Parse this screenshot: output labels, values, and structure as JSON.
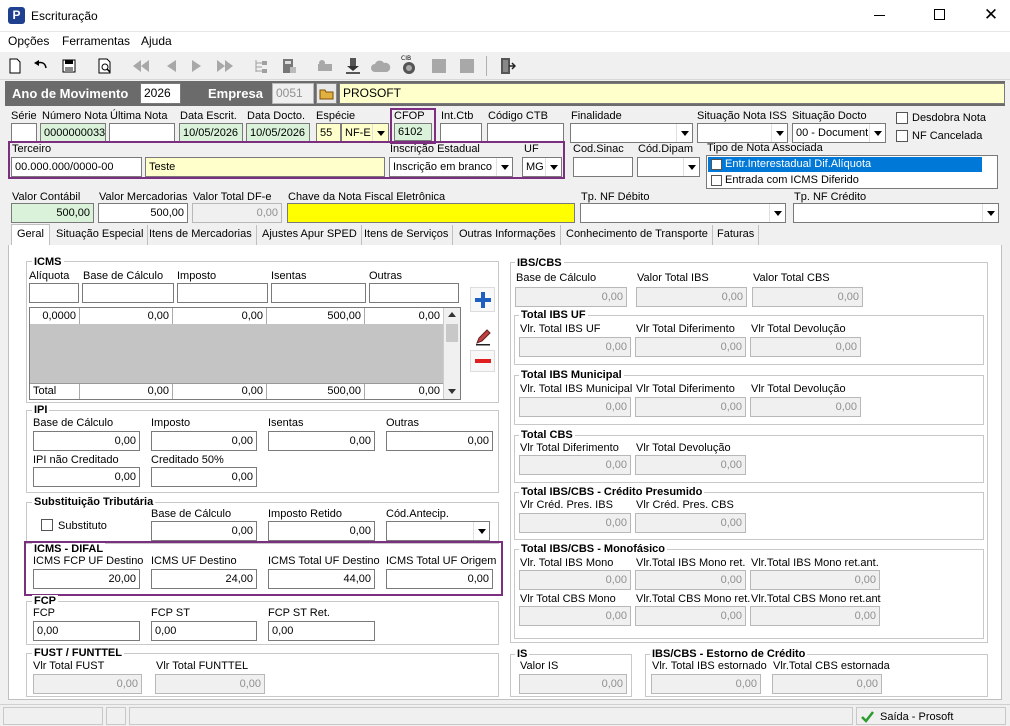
{
  "window": {
    "title": "Escrituração",
    "logo": "P"
  },
  "menu": [
    "Opções",
    "Ferramentas",
    "Ajuda"
  ],
  "top": {
    "ano_label": "Ano de Movimento",
    "ano": "2026",
    "empresa_label": "Empresa",
    "empresa_code": "0051",
    "empresa_name": "PROSOFT"
  },
  "labels": {
    "serie": "Série",
    "numero": "Número Nota",
    "ultima": "Última Nota",
    "data_escrit": "Data Escrit.",
    "data_docto": "Data Docto.",
    "especie": "Espécie",
    "cfop": "CFOP",
    "int_ctb": "Int.Ctb",
    "cod_ctb": "Código CTB",
    "finalidade": "Finalidade",
    "sit_iss": "Situação Nota ISS",
    "sit_docto": "Situação Docto",
    "desdobra": "Desdobra Nota",
    "nf_cancelada": "NF Cancelada",
    "terceiro": "Terceiro",
    "insc_est": "Inscrição Estadual",
    "uf": "UF",
    "cod_sinac": "Cod.Sinac",
    "cod_dipam": "Cód.Dipam",
    "tipo_nota": "Tipo de Nota Associada",
    "valor_contabil": "Valor Contábil",
    "valor_merc": "Valor Mercadorias",
    "valor_dfe": "Valor Total DF-e",
    "chave": "Chave da Nota Fiscal Eletrônica",
    "tp_deb": "Tp. NF Débito",
    "tp_cred": "Tp. NF Crédito"
  },
  "values": {
    "numero": "0000000033",
    "data_escrit": "10/05/2026",
    "data_docto": "10/05/2026",
    "especie_code": "55",
    "especie": "NF-E",
    "cfop": "6102",
    "sit_docto": "00 - Document",
    "terceiro_doc": "00.000.000/0000-00",
    "terceiro_nome": "Teste",
    "insc_est": "Inscrição em branco",
    "uf": "MG",
    "valor_contabil": "500,00",
    "valor_merc": "500,00",
    "valor_dfe": "0,00"
  },
  "tipo_nota_items": [
    "Entr.Interestadual Dif.Alíquota",
    "Entrada com ICMS Diferido"
  ],
  "tabs": [
    "Geral",
    "Situação Especial",
    "Itens de Mercadorias",
    "Ajustes Apur SPED",
    "Itens de Serviços",
    "Outras Informações",
    "Conhecimento de Transporte",
    "Faturas"
  ],
  "icms": {
    "title": "ICMS",
    "cols": [
      "Alíquota",
      "Base de Cálculo",
      "Imposto",
      "Isentas",
      "Outras"
    ],
    "row": [
      "0,0000",
      "0,00",
      "0,00",
      "500,00",
      "0,00"
    ],
    "total_label": "Total",
    "total": [
      "0,00",
      "0,00",
      "500,00",
      "0,00"
    ]
  },
  "ipi": {
    "title": "IPI",
    "base_l": "Base de Cálculo",
    "imposto_l": "Imposto",
    "isentas_l": "Isentas",
    "outras_l": "Outras",
    "base": "0,00",
    "imposto": "0,00",
    "isentas": "0,00",
    "outras": "0,00",
    "nao_cred_l": "IPI não Creditado",
    "cred50_l": "Creditado 50%",
    "nao_cred": "0,00",
    "cred50": "0,00"
  },
  "st": {
    "title": "Substituição Tributária",
    "substituto": "Substituto",
    "base_l": "Base de Cálculo",
    "ret_l": "Imposto Retido",
    "antecip_l": "Cód.Antecip.",
    "base": "0,00",
    "ret": "0,00"
  },
  "difal": {
    "title": "ICMS - DIFAL",
    "fcp_l": "ICMS FCP UF Destino",
    "uf_dest_l": "ICMS UF Destino",
    "tot_dest_l": "ICMS Total UF Destino",
    "tot_orig_l": "ICMS Total UF Origem",
    "fcp": "20,00",
    "uf_dest": "24,00",
    "tot_dest": "44,00",
    "tot_orig": "0,00"
  },
  "fcp": {
    "title": "FCP",
    "fcp_l": "FCP",
    "st_l": "FCP ST",
    "ret_l": "FCP ST Ret.",
    "fcp": "0,00",
    "st": "0,00",
    "ret": "0,00"
  },
  "fust": {
    "title": "FUST / FUNTTEL",
    "fust_l": "Vlr Total FUST",
    "funttel_l": "Vlr Total FUNTTEL",
    "fust": "0,00",
    "funttel": "0,00"
  },
  "ibs": {
    "title": "IBS/CBS",
    "base_l": "Base de Cálculo",
    "tot_ibs_l": "Valor Total IBS",
    "tot_cbs_l": "Valor Total CBS",
    "base": "0,00",
    "tot_ibs": "0,00",
    "tot_cbs": "0,00"
  },
  "ibs_uf": {
    "title": "Total IBS UF",
    "a_l": "Vlr. Total IBS UF",
    "b_l": "Vlr Total Diferimento",
    "c_l": "Vlr Total Devolução",
    "a": "0,00",
    "b": "0,00",
    "c": "0,00"
  },
  "ibs_mun": {
    "title": "Total IBS Municipal",
    "a_l": "Vlr. Total IBS Municipal",
    "b_l": "Vlr Total Diferimento",
    "c_l": "Vlr Total Devolução",
    "a": "0,00",
    "b": "0,00",
    "c": "0,00"
  },
  "cbs": {
    "title": "Total CBS",
    "a_l": "Vlr Total Diferimento",
    "b_l": "Vlr Total Devolução",
    "a": "0,00",
    "b": "0,00"
  },
  "presumido": {
    "title": "Total IBS/CBS - Crédito Presumido",
    "a_l": "Vlr Créd. Pres. IBS",
    "b_l": "Vlr Créd. Pres. CBS",
    "a": "0,00",
    "b": "0,00"
  },
  "mono": {
    "title": "Total IBS/CBS - Monofásico",
    "a_l": "Vlr. Total IBS Mono",
    "b_l": "Vlr.Total IBS Mono ret.",
    "c_l": "Vlr.Total IBS Mono ret.ant.",
    "d_l": "Vlr Total CBS Mono",
    "e_l": "Vlr.Total CBS Mono ret.",
    "f_l": "Vlr.Total CBS Mono ret.ant",
    "a": "0,00",
    "b": "0,00",
    "c": "0,00",
    "d": "0,00",
    "e": "0,00",
    "f": "0,00"
  },
  "is": {
    "title": "IS",
    "valor_l": "Valor IS",
    "valor": "0,00"
  },
  "estorno": {
    "title": "IBS/CBS - Estorno de Crédito",
    "a_l": "Vlr. Total IBS estornado",
    "b_l": "Vlr.Total CBS estornada",
    "a": "0,00",
    "b": "0,00"
  },
  "status": {
    "text": "Saída - Prosoft"
  }
}
